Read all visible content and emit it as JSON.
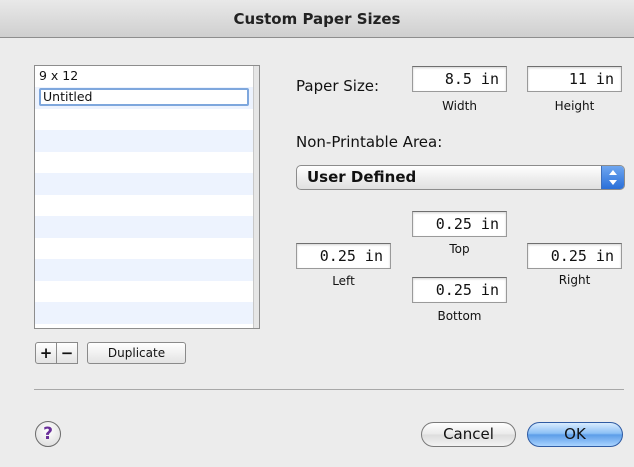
{
  "window": {
    "title": "Custom Paper Sizes"
  },
  "list": {
    "items": [
      "9 x 12",
      "Untitled"
    ]
  },
  "list_buttons": {
    "add": "+",
    "remove": "−",
    "duplicate": "Duplicate"
  },
  "paper_size": {
    "label": "Paper Size:",
    "width_value": "8.5 in",
    "width_label": "Width",
    "height_value": "11 in",
    "height_label": "Height"
  },
  "non_printable": {
    "label": "Non-Printable Area:",
    "popup_value": "User Defined",
    "top_value": "0.25 in",
    "top_label": "Top",
    "left_value": "0.25 in",
    "left_label": "Left",
    "right_value": "0.25 in",
    "right_label": "Right",
    "bottom_value": "0.25 in",
    "bottom_label": "Bottom"
  },
  "footer": {
    "help": "?",
    "cancel": "Cancel",
    "ok": "OK"
  },
  "colors": {
    "accent": "#5c9de8",
    "selection_border": "#7ea7dd",
    "stripe": "#edf3fe"
  }
}
